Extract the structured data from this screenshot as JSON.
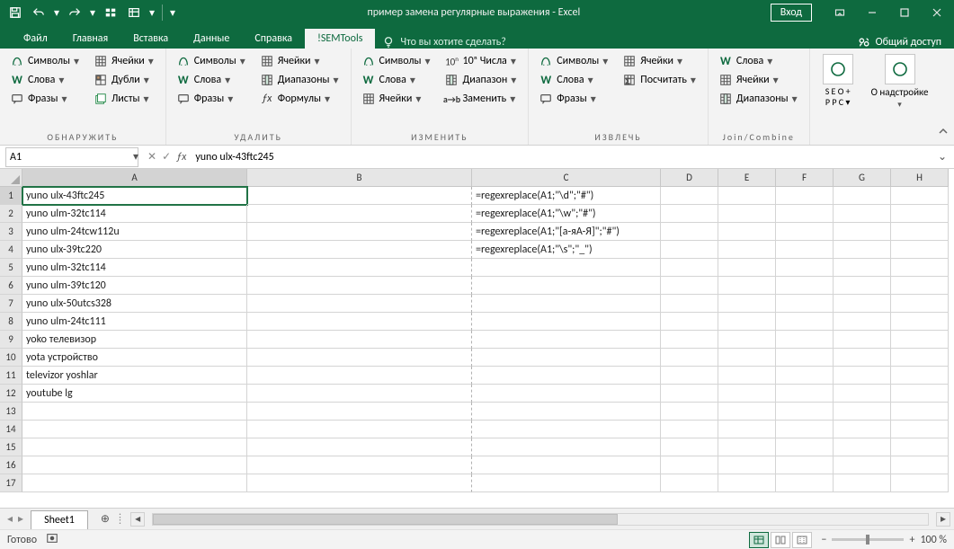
{
  "title": "пример замена регулярные выражения  -  Excel",
  "login": "Вход",
  "tabs": [
    "Файл",
    "Главная",
    "Вставка",
    "Данные",
    "Справка",
    "!SEMTools"
  ],
  "active_tab": 5,
  "tell_me": "Что вы хотите сделать?",
  "share": "Общий доступ",
  "groups": [
    {
      "label": "ОБНАРУЖИТЬ",
      "cols": [
        [
          {
            "t": "Символы",
            "i": "sym"
          },
          {
            "t": "Слова",
            "i": "w"
          },
          {
            "t": "Фразы",
            "i": "phr"
          }
        ],
        [
          {
            "t": "Ячейки",
            "i": "cells"
          },
          {
            "t": "Дубли",
            "i": "dup"
          },
          {
            "t": "Листы",
            "i": "sheets"
          }
        ]
      ]
    },
    {
      "label": "УДАЛИТЬ",
      "cols": [
        [
          {
            "t": "Символы",
            "i": "sym"
          },
          {
            "t": "Слова",
            "i": "w"
          },
          {
            "t": "Фразы",
            "i": "phr"
          }
        ],
        [
          {
            "t": "Ячейки",
            "i": "cells"
          },
          {
            "t": "Диапазоны",
            "i": "range"
          },
          {
            "t": "Формулы",
            "i": "fx"
          }
        ]
      ]
    },
    {
      "label": "ИЗМЕНИТЬ",
      "cols": [
        [
          {
            "t": "Символы",
            "i": "sym"
          },
          {
            "t": "Слова",
            "i": "w"
          },
          {
            "t": "Ячейки",
            "i": "cells"
          }
        ],
        [
          {
            "t": "10ⁿ Числа",
            "i": "num"
          },
          {
            "t": "Диапазон",
            "i": "range"
          },
          {
            "t": "Заменить",
            "i": "repl"
          }
        ]
      ]
    },
    {
      "label": "ИЗВЛЕЧЬ",
      "cols": [
        [
          {
            "t": "Символы",
            "i": "sym"
          },
          {
            "t": "Слова",
            "i": "w"
          },
          {
            "t": "Фразы",
            "i": "phr"
          }
        ],
        [
          {
            "t": "Ячейки",
            "i": "cells"
          },
          {
            "t": "Посчитать",
            "i": "count"
          }
        ]
      ]
    },
    {
      "label": "Join/Combine",
      "cols": [
        [
          {
            "t": "Слова",
            "i": "w"
          },
          {
            "t": "Ячейки",
            "i": "cells"
          },
          {
            "t": "Диапазоны",
            "i": "range"
          }
        ]
      ]
    }
  ],
  "seo": "S E O +\nP P C ▾",
  "about": "О надстройке",
  "name_box": "A1",
  "formula": "yuno ulx-43ftc245",
  "cols": [
    "A",
    "B",
    "C",
    "D",
    "E",
    "F",
    "G",
    "H"
  ],
  "rows": [
    [
      "yuno ulx-43ftc245",
      "",
      "=regexreplace(A1;\"\\d\";\"#\")"
    ],
    [
      "yuno ulm-32tc114",
      "",
      "=regexreplace(A1;\"\\w\";\"#\")"
    ],
    [
      "yuno ulm-24tcw112u",
      "",
      "=regexreplace(A1;\"[а-яА-Я]\";\"#\")"
    ],
    [
      "yuno ulx-39tc220",
      "",
      "=regexreplace(A1;\"\\s\";\"_\")"
    ],
    [
      "yuno ulm-32tc114",
      "",
      ""
    ],
    [
      "yuno ulm-39tc120",
      "",
      ""
    ],
    [
      "yuno ulx-50utcs328",
      "",
      ""
    ],
    [
      "yuno ulm-24tc111",
      "",
      ""
    ],
    [
      "yoko телевизор",
      "",
      ""
    ],
    [
      "yota устройство",
      "",
      ""
    ],
    [
      "televizor yoshlar",
      "",
      ""
    ],
    [
      "youtube lg",
      "",
      ""
    ],
    [
      "",
      "",
      ""
    ],
    [
      "",
      "",
      ""
    ],
    [
      "",
      "",
      ""
    ],
    [
      "",
      "",
      ""
    ],
    [
      "",
      "",
      ""
    ]
  ],
  "sheet_tab": "Sheet1",
  "status": "Готово",
  "zoom": "100 %"
}
